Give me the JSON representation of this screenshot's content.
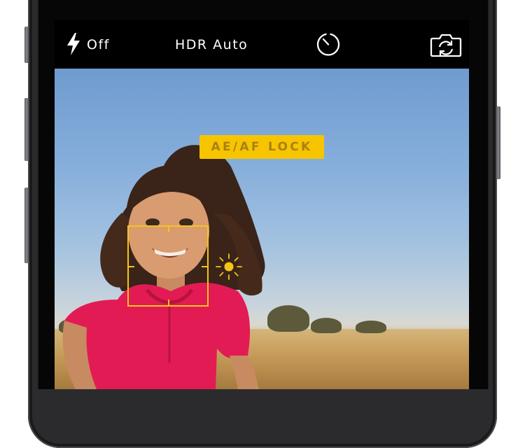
{
  "camera": {
    "flash": {
      "label": "Off",
      "icon": "flash-icon"
    },
    "hdr": {
      "label": "HDR Auto"
    },
    "timer": {
      "icon": "timer-icon"
    },
    "switch_camera": {
      "icon": "camera-switch-icon"
    },
    "ae_af_lock": {
      "label": "AE/AF LOCK"
    },
    "accent_color": "#f5c518",
    "badge_color": "#f7c400",
    "focus_square": {
      "icon": "focus-square"
    },
    "exposure": {
      "icon": "sun-exposure-icon"
    }
  }
}
